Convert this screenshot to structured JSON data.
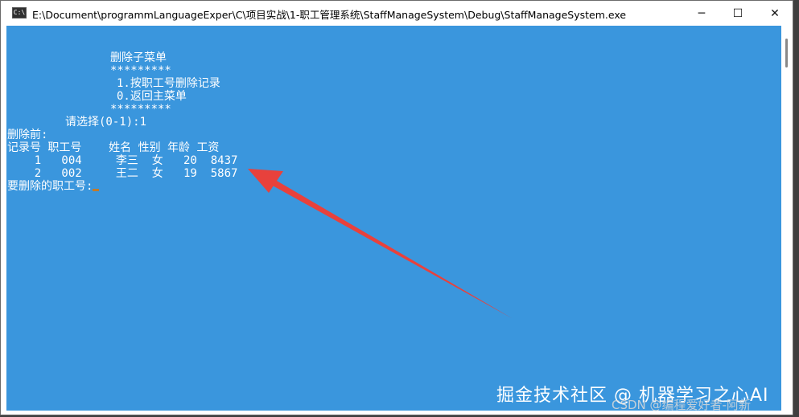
{
  "window": {
    "title": "E:\\Document\\programmLanguageExper\\C\\项目实战\\1-职工管理系统\\StaffManageSystem\\Debug\\StaffManageSystem.exe",
    "icon_label": "C:\\",
    "minimize": "─",
    "maximize": "☐",
    "close": "✕"
  },
  "console": {
    "menu_title": "删除子菜单",
    "stars_top": "*********",
    "option_1": "1.按职工号删除记录",
    "option_0": "0.返回主菜单",
    "stars_bottom": "*********",
    "prompt_choice": "请选择(0-1):1",
    "before_delete": "删除前:",
    "table_header": "记录号 职工号    姓名 性别 年龄 工资",
    "rows": [
      "    1   004     李三  女   20  8437",
      "    2   002     王二  女   19  5867"
    ],
    "prompt_id": "要删除的职工号:"
  },
  "colors": {
    "console_bg": "#3a96dd",
    "arrow": "#e8413c"
  },
  "watermark": {
    "text": "掘金技术社区 @ 机器学习之心AI",
    "sub": "CSDN @编程爱好者-阿新"
  }
}
